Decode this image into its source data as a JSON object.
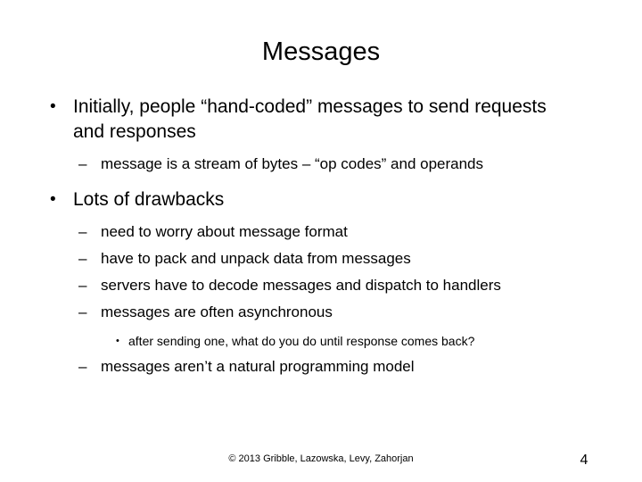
{
  "slide": {
    "title": "Messages",
    "background_color": "#ffffff",
    "text_color": "#000000",
    "bullets": {
      "b1": {
        "marker": "•",
        "text": "Initially, people “hand-coded” messages to send requests and responses"
      },
      "b1_sub1": {
        "marker": "–",
        "text": "message is a stream of bytes – “op codes” and operands"
      },
      "b2": {
        "marker": "•",
        "text": "Lots of drawbacks"
      },
      "b2_sub1": {
        "marker": "–",
        "text": "need to worry about message format"
      },
      "b2_sub2": {
        "marker": "–",
        "text": "have to pack and unpack data from messages"
      },
      "b2_sub3": {
        "marker": "–",
        "text": "servers have to decode messages and dispatch to handlers"
      },
      "b2_sub4": {
        "marker": "–",
        "text": "messages are often asynchronous"
      },
      "b2_sub4_sub1": {
        "marker": "•",
        "text": "after sending one, what do you do until response comes back?"
      },
      "b2_sub5": {
        "marker": "–",
        "text": "messages aren’t a natural programming model"
      }
    },
    "footer": {
      "copyright": "© 2013 Gribble, Lazowska, Levy, Zahorjan",
      "page_number": "4"
    }
  }
}
